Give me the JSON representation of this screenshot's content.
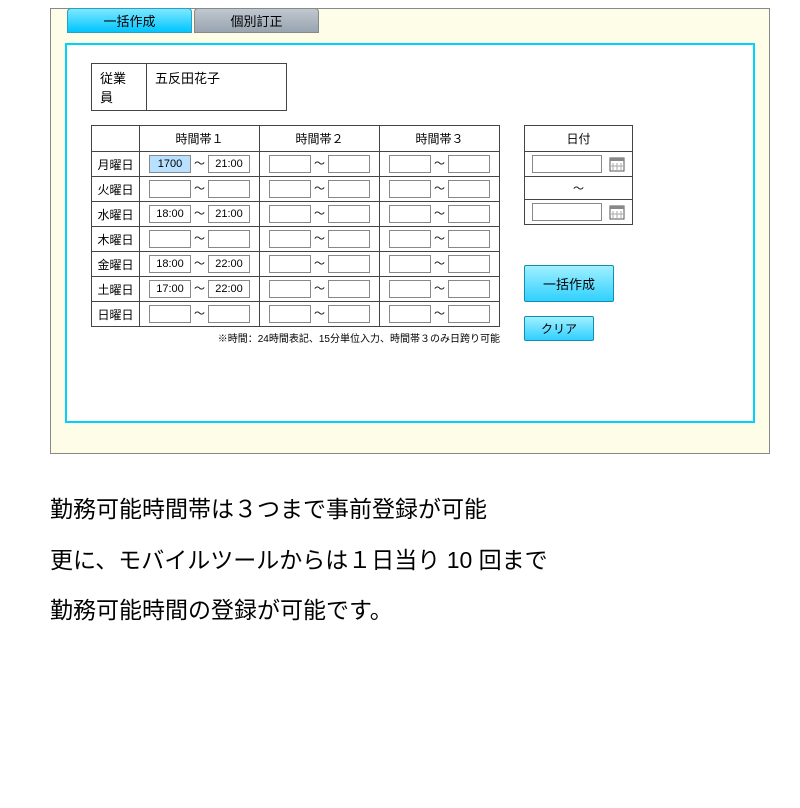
{
  "tabs": {
    "bulk": "一括作成",
    "individual": "個別訂正"
  },
  "employee": {
    "label": "従業員",
    "name": "五反田花子"
  },
  "headers": {
    "slot1": "時間帯１",
    "slot2": "時間帯２",
    "slot3": "時間帯３",
    "date": "日付"
  },
  "days": [
    {
      "label": "月曜日",
      "s1_from": "1700",
      "s1_to": "21:00",
      "s1_hl": true
    },
    {
      "label": "火曜日",
      "s1_from": "",
      "s1_to": ""
    },
    {
      "label": "水曜日",
      "s1_from": "18:00",
      "s1_to": "21:00"
    },
    {
      "label": "木曜日",
      "s1_from": "",
      "s1_to": ""
    },
    {
      "label": "金曜日",
      "s1_from": "18:00",
      "s1_to": "22:00"
    },
    {
      "label": "土曜日",
      "s1_from": "17:00",
      "s1_to": "22:00"
    },
    {
      "label": "日曜日",
      "s1_from": "",
      "s1_to": ""
    }
  ],
  "tilde": "〜",
  "note": "※時間：24時間表記、15分単位入力、時間帯３のみ日跨り可能",
  "buttons": {
    "bulk": "一括作成",
    "clear": "クリア"
  },
  "description": {
    "l1": "勤務可能時間帯は３つまで事前登録が可能",
    "l2": "更に、モバイルツールからは１日当り 10 回まで",
    "l3": "勤務可能時間の登録が可能です。"
  }
}
